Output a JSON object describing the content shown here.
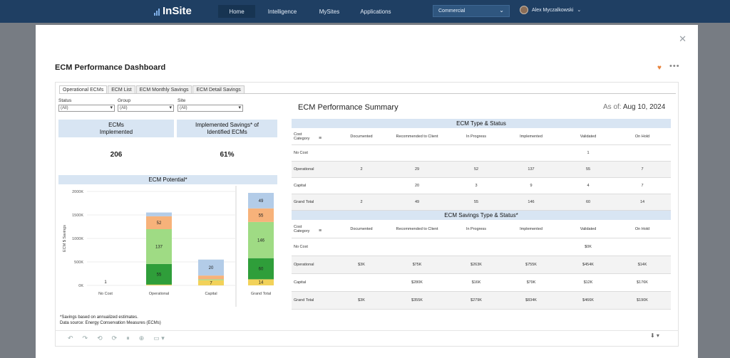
{
  "nav": {
    "logo": "InSite",
    "items": [
      "Home",
      "Intelligence",
      "MySites",
      "Applications"
    ],
    "region": "Commercial",
    "user": "Alex Myczalkowski"
  },
  "dashboard": {
    "title": "ECM Performance Dashboard",
    "tabs": [
      "Operational ECMs",
      "ECM List",
      "ECM Monthly Savings",
      "ECM Detail Savings"
    ],
    "filters": [
      {
        "label": "Status",
        "value": "(All)"
      },
      {
        "label": "Group",
        "value": "(All)"
      },
      {
        "label": "Site",
        "value": "(All)"
      }
    ],
    "kpis": [
      {
        "header": "ECMs Implemented",
        "value": "206"
      },
      {
        "header": "Implemented Savings* of Identified ECMs",
        "value": "61%"
      }
    ],
    "summary_title": "ECM Performance Summary",
    "as_of_label": "As of:",
    "as_of_date": "Aug 10, 2024",
    "footnote_1": "*Savings based on annualized estimates.",
    "footnote_2": "Data source: Energy Conservation Measures (ECMs)"
  },
  "type_status": {
    "title": "ECM Type & Status",
    "columns": [
      "Cost Category",
      "Documented",
      "Recommended to Client",
      "In Progress",
      "Implemented",
      "Validated",
      "On Hold"
    ],
    "rows": [
      [
        "No Cost",
        "",
        "",
        "",
        "",
        "1",
        ""
      ],
      [
        "Operational",
        "2",
        "29",
        "52",
        "137",
        "55",
        "7"
      ],
      [
        "Capital",
        "",
        "20",
        "3",
        "9",
        "4",
        "7"
      ],
      [
        "Grand Total",
        "2",
        "49",
        "55",
        "146",
        "60",
        "14"
      ]
    ]
  },
  "savings_status": {
    "title": "ECM Savings Type & Status*",
    "columns": [
      "Cost Category",
      "Documented",
      "Recommended to Client",
      "In Progress",
      "Implemented",
      "Validated",
      "On Hold"
    ],
    "rows": [
      [
        "No Cost",
        "",
        "",
        "",
        "",
        "$0K",
        ""
      ],
      [
        "Operational",
        "$3K",
        "$75K",
        "$263K",
        "$755K",
        "$454K",
        "$14K"
      ],
      [
        "Capital",
        "",
        "$280K",
        "$16K",
        "$79K",
        "$12K",
        "$176K"
      ],
      [
        "Grand Total",
        "$3K",
        "$355K",
        "$279K",
        "$834K",
        "$466K",
        "$190K"
      ]
    ]
  },
  "chart_data": {
    "type": "bar",
    "title": "ECM Potential*",
    "ylabel": "ECM $ Savings",
    "xlabel": "",
    "categories": [
      "No Cost",
      "Operational",
      "Capital",
      "Grand Total"
    ],
    "ylim": [
      0,
      2000000
    ],
    "yticks": [
      "0K",
      "500K",
      "1000K",
      "1500K",
      "2000K"
    ],
    "stacked": true,
    "series": [
      {
        "color": "#f2d25a",
        "values": [
          0,
          17000,
          110000,
          130000
        ],
        "labels": [
          "",
          "",
          "7",
          "14"
        ]
      },
      {
        "color": "#2f9e3a",
        "values": [
          0,
          440000,
          0,
          450000
        ],
        "labels": [
          "",
          "55",
          "",
          "60"
        ]
      },
      {
        "color": "#9fdb84",
        "values": [
          0,
          740000,
          20000,
          770000
        ],
        "labels": [
          "",
          "137",
          "",
          "146"
        ]
      },
      {
        "color": "#f7b27a",
        "values": [
          0,
          275000,
          80000,
          290000
        ],
        "labels": [
          "",
          "52",
          "",
          "55"
        ]
      },
      {
        "color": "#b3cce8",
        "values": [
          0,
          80000,
          340000,
          330000
        ],
        "labels": [
          "",
          "",
          "20",
          "49"
        ]
      }
    ],
    "point_labels": [
      {
        "category": "No Cost",
        "value": 0,
        "label": "1"
      }
    ]
  }
}
